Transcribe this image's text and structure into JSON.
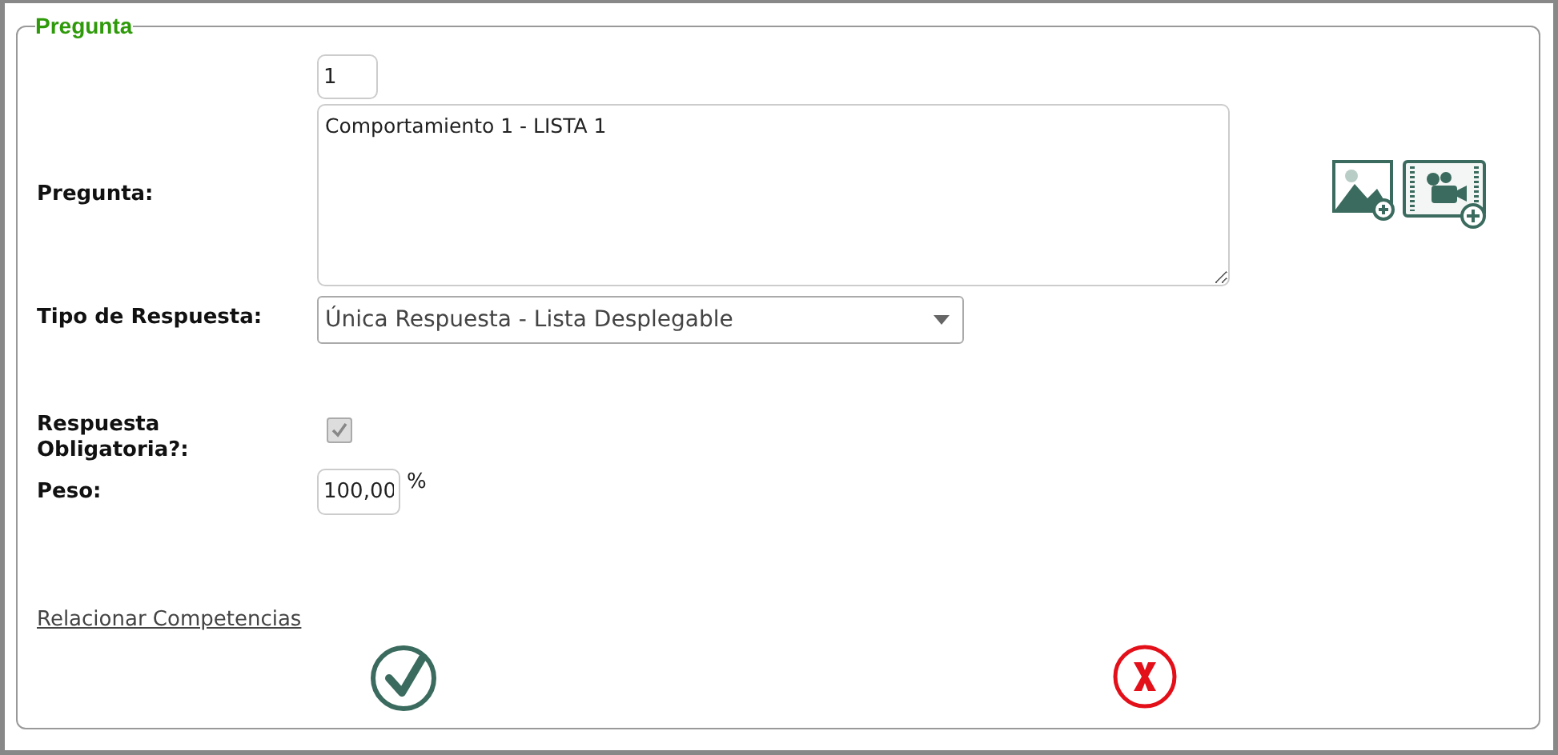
{
  "section": {
    "legend": "Pregunta"
  },
  "number_field": {
    "value": "1"
  },
  "question": {
    "label": "Pregunta:",
    "value": "Comportamiento 1 - LISTA 1"
  },
  "answer_type": {
    "label": "Tipo de Respuesta:",
    "value": "Única Respuesta - Lista Desplegable"
  },
  "required": {
    "label": "Respuesta Obligatoria?:",
    "checked": true,
    "disabled": true
  },
  "weight": {
    "label": "Peso:",
    "value": "100,00",
    "unit": "%"
  },
  "link": "Relacionar Competencias"
}
